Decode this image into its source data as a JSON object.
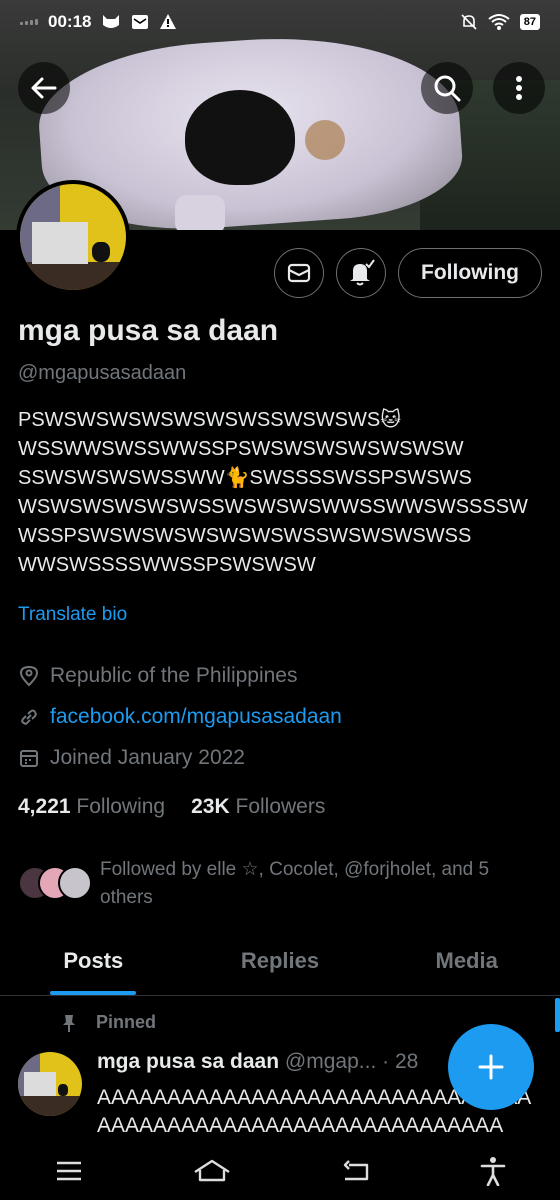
{
  "status_bar": {
    "time": "00:18",
    "battery": "87",
    "icons": [
      "cat-icon",
      "mail-icon",
      "alert-icon",
      "notifications-off-icon",
      "wifi-icon",
      "battery-icon"
    ]
  },
  "header": {
    "back_icon": "arrow-left-icon",
    "search_icon": "search-icon",
    "more_icon": "more-vertical-icon"
  },
  "profile": {
    "display_name": "mga pusa sa daan",
    "handle": "@mgapusasadaan",
    "bio": "PSWSWSWSWSWSWSWSSWSWSWS🐱\nWSSWWSWSSWWSSPSWSWSWSWSWSWSW\nSSWSWSWSWSSWW🐈SWSSSSWSSPSWSWS\nWSWSWSWSWSWSSWSWSWSWWSSWWSWSSSSW\nWSSPSWSWSWSWSWSWSWSSWSWSWSWSS\nWWSWSSSSWWSSPSWSWSW",
    "translate_label": "Translate bio",
    "location": "Republic of the Philippines",
    "website": "facebook.com/mgapusasadaan",
    "joined": "Joined January 2022",
    "following_count": "4,221",
    "following_label": "Following",
    "followers_count": "23K",
    "followers_label": "Followers",
    "followed_by": "Followed by elle ☆, Cocolet, @forjholet, and 5 others",
    "follow_button_label": "Following"
  },
  "tabs": [
    {
      "label": "Posts",
      "active": true
    },
    {
      "label": "Replies",
      "active": false
    },
    {
      "label": "Media",
      "active": false
    }
  ],
  "pinned_post": {
    "pinned_label": "Pinned",
    "author_name": "mga pusa sa daan",
    "author_handle": "@mgap...",
    "time": "· 28",
    "text": "AAAAAAAAAAAAAAAAAAAAAAAAAAAAAAAAAAAAAAAAAAAAAAAAAAAAAAAAAAAA"
  },
  "colors": {
    "accent": "#1d9bf0",
    "background": "#000000",
    "secondary_text": "#71767b"
  }
}
